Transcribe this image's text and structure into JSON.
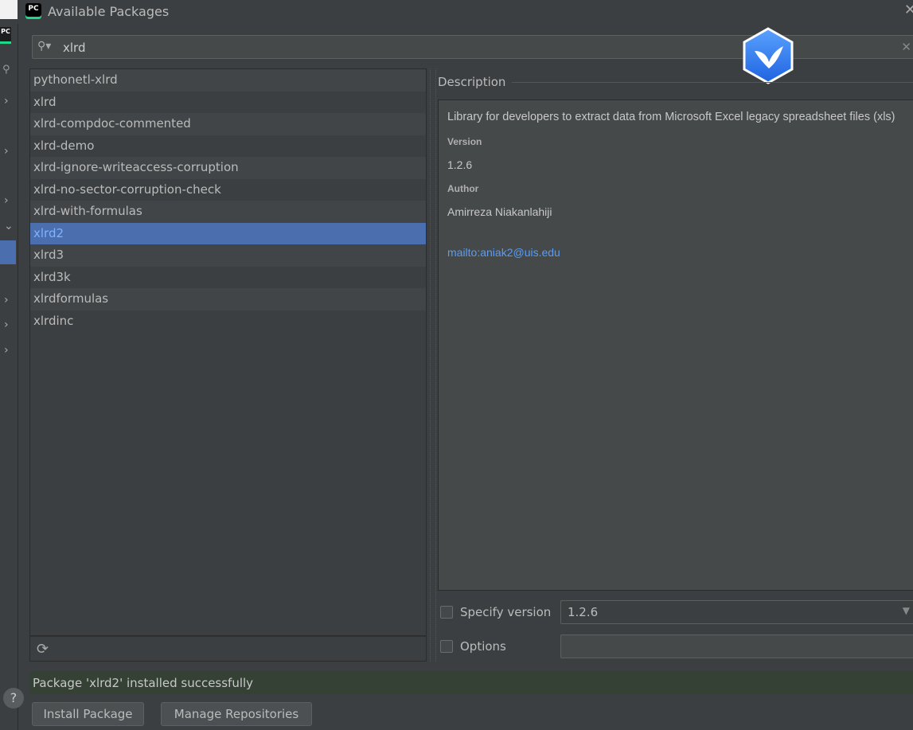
{
  "window": {
    "title": "Available Packages",
    "app_icon_label": "PC"
  },
  "search": {
    "value": "xlrd",
    "placeholder": ""
  },
  "packages": [
    "pythonetl-xlrd",
    "xlrd",
    "xlrd-compdoc-commented",
    "xlrd-demo",
    "xlrd-ignore-writeaccess-corruption",
    "xlrd-no-sector-corruption-check",
    "xlrd-with-formulas",
    "xlrd2",
    "xlrd3",
    "xlrd3k",
    "xlrdformulas",
    "xlrdinc"
  ],
  "selected_package": "xlrd2",
  "description": {
    "header": "Description",
    "text": "Library for developers to extract data from Microsoft Excel legacy spreadsheet files (xls)",
    "version_label": "Version",
    "version": "1.2.6",
    "author_label": "Author",
    "author": "Amirreza Niakanlahiji",
    "link": "mailto:aniak2@uis.edu"
  },
  "options": {
    "specify_version_label": "Specify version",
    "version_value": "1.2.6",
    "options_label": "Options",
    "options_value": ""
  },
  "status": {
    "message": "Package 'xlrd2' installed successfully"
  },
  "buttons": {
    "install": "Install Package",
    "manage": "Manage Repositories"
  },
  "colors": {
    "selection": "#4b6eaf",
    "link": "#589df6",
    "status_bg": "#344134"
  }
}
